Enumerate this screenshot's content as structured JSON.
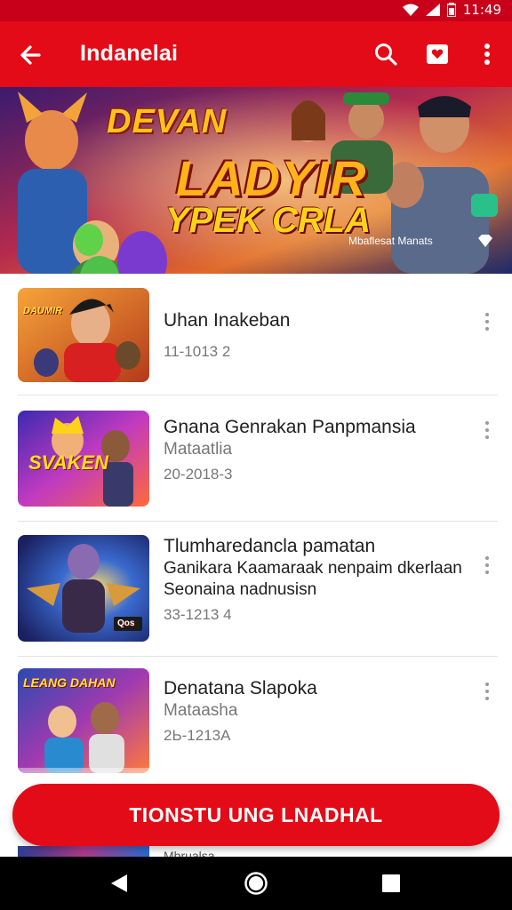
{
  "status_bar": {
    "time": "11:49"
  },
  "app_bar": {
    "title": "Indanelai"
  },
  "banner": {
    "line1": "DEVAN",
    "line2": "LADYIR",
    "line3": "YPEK CRLA",
    "caption": "Mbaflesat Manats"
  },
  "items": [
    {
      "title": "Uhan Inakeban",
      "subtitle": "",
      "date": "11-1013 2",
      "thumb_text": "DAUMIR"
    },
    {
      "title": "Gnana Genrakan Panpmansia",
      "subtitle": "Mataatlia",
      "date": "20-2018-3",
      "thumb_text": "SVAKEN"
    },
    {
      "title": "Tlumharedancla pamatan",
      "subtitle": "Ganikara Kaamaraak nenpaim dkerlaan Seonaina nadnusisn",
      "date": "33-1213 4",
      "thumb_text": ""
    },
    {
      "title": "Denatana Slapoka",
      "subtitle": "Mataasha",
      "date": "2Ь-1213А",
      "thumb_text": "LEANG DAHAN"
    }
  ],
  "peek_item": {
    "title": "Mbrualsa"
  },
  "cta_label": "TIONSTU UNG LNADHAL",
  "colors": {
    "accent": "#e30b17",
    "status": "#c8001a"
  }
}
